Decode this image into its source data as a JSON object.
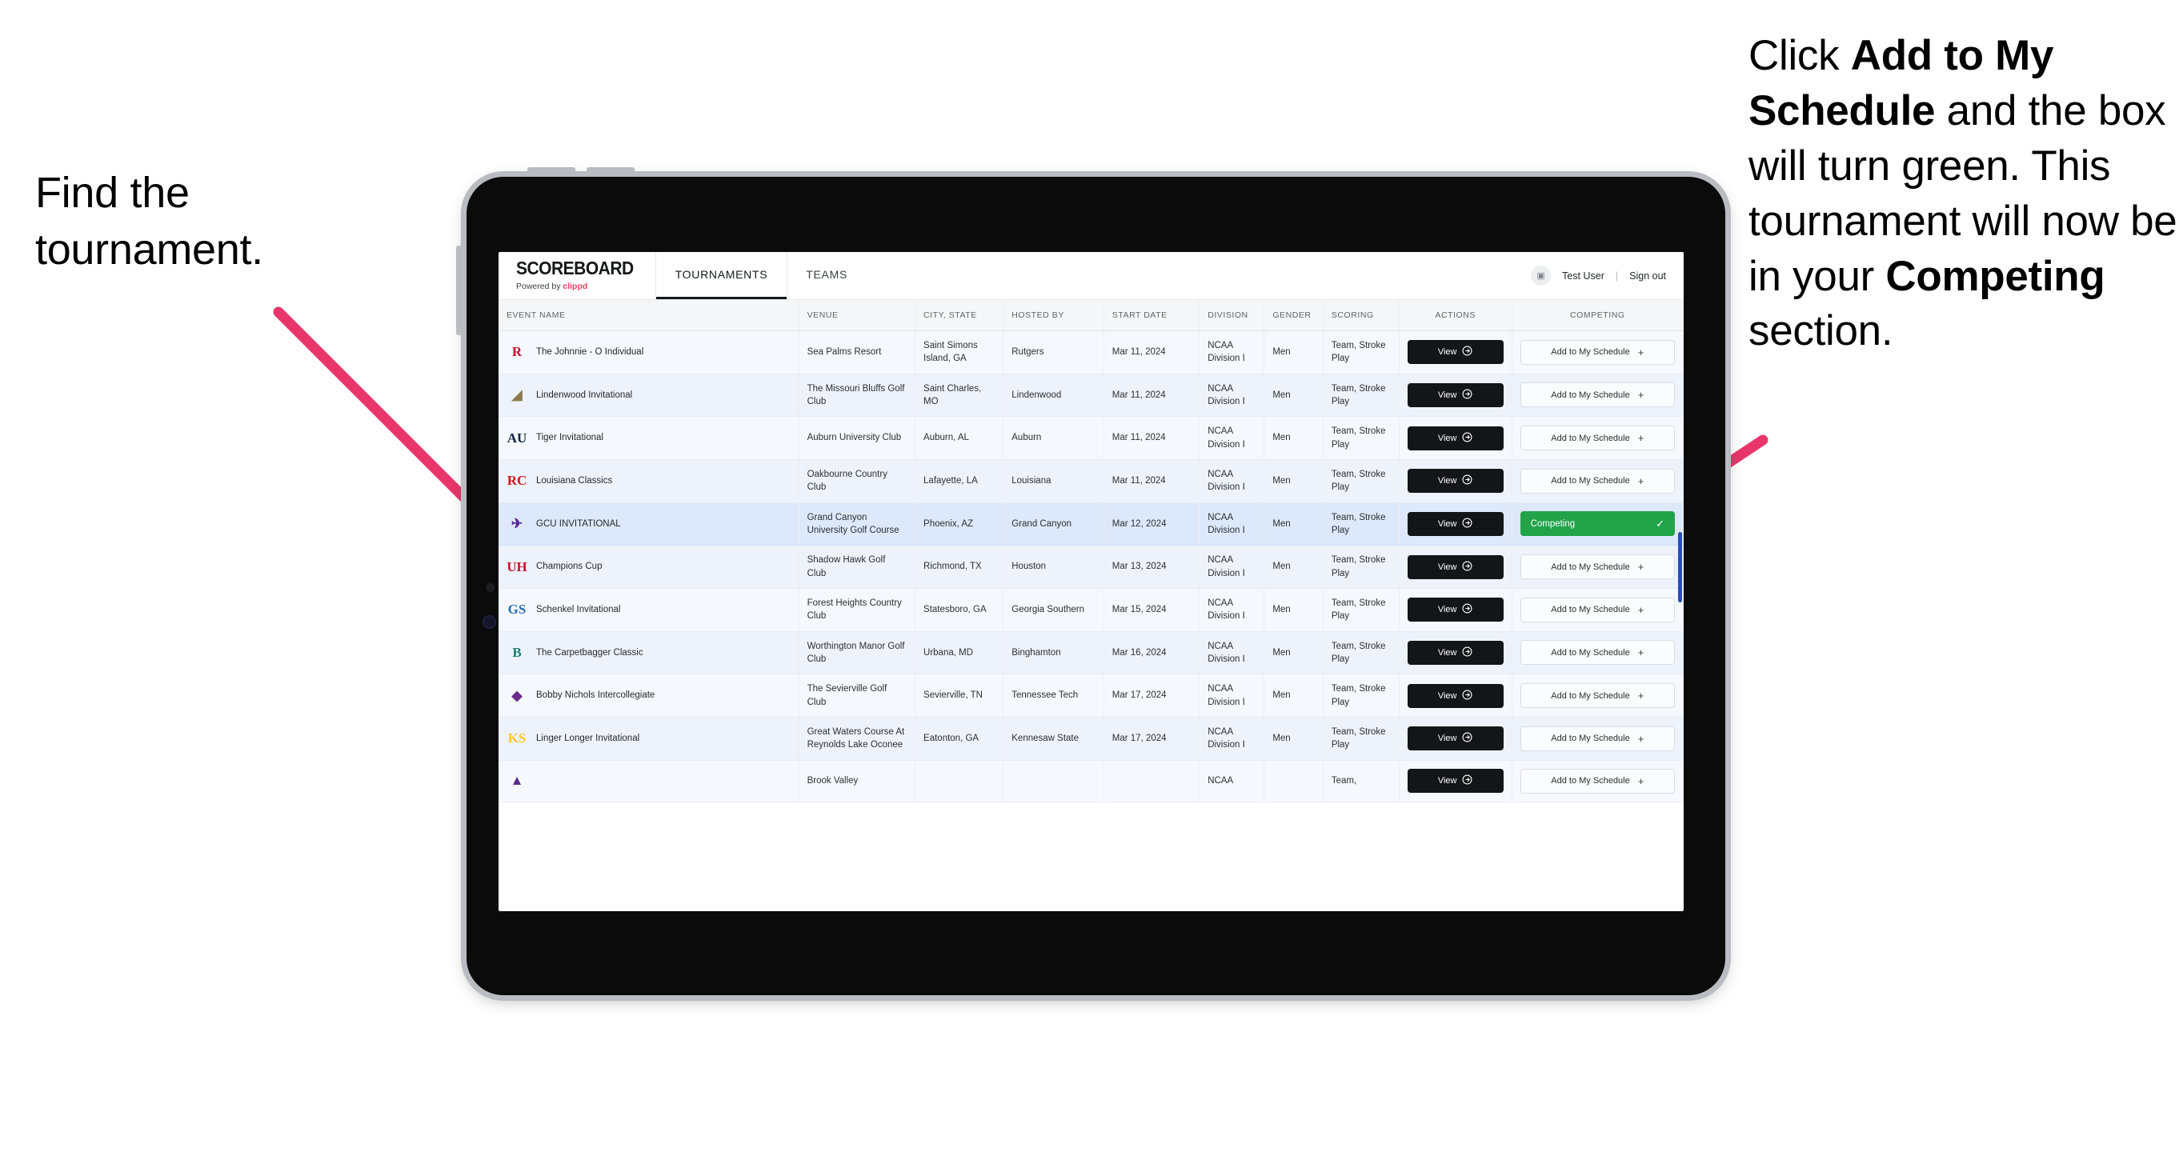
{
  "annotations": {
    "left": {
      "line1": "Find the",
      "line2": "tournament."
    },
    "right": {
      "part1": "Click ",
      "bold1": "Add to My Schedule",
      "part2": " and the box will turn green. This tournament will now be in your ",
      "bold2": "Competing",
      "part3": " section."
    },
    "arrow_color": "#e8366b"
  },
  "app": {
    "brand": {
      "name": "SCOREBOARD",
      "powered_prefix": "Powered by ",
      "powered_brand": "clippd"
    },
    "tabs": [
      {
        "label": "TOURNAMENTS",
        "active": true
      },
      {
        "label": "TEAMS",
        "active": false
      }
    ],
    "header_right": {
      "avatar_icon": "user-avatar-icon",
      "user_name": "Test User",
      "separator": "|",
      "sign_out": "Sign out"
    }
  },
  "table": {
    "columns": [
      "EVENT NAME",
      "VENUE",
      "CITY, STATE",
      "HOSTED BY",
      "START DATE",
      "DIVISION",
      "GENDER",
      "SCORING",
      "ACTIONS",
      "COMPETING"
    ],
    "action_label": "View",
    "add_label": "Add to My Schedule",
    "add_icon": "plus-icon",
    "competing_label": "Competing",
    "competing_icon": "check-icon",
    "competing_color": "#22a34a",
    "rows": [
      {
        "logo": "R",
        "logo_color": "#c8102e",
        "event": "The Johnnie - O Individual",
        "venue": "Sea Palms Resort",
        "city": "Saint Simons Island, GA",
        "hosted_by": "Rutgers",
        "start_date": "Mar 11, 2024",
        "division": "NCAA Division I",
        "gender": "Men",
        "scoring": "Team, Stroke Play",
        "competing": false
      },
      {
        "logo": "◢",
        "logo_color": "#8a7b4f",
        "event": "Lindenwood Invitational",
        "venue": "The Missouri Bluffs Golf Club",
        "city": "Saint Charles, MO",
        "hosted_by": "Lindenwood",
        "start_date": "Mar 11, 2024",
        "division": "NCAA Division I",
        "gender": "Men",
        "scoring": "Team, Stroke Play",
        "competing": false
      },
      {
        "logo": "AU",
        "logo_color": "#0c2340",
        "event": "Tiger Invitational",
        "venue": "Auburn University Club",
        "city": "Auburn, AL",
        "hosted_by": "Auburn",
        "start_date": "Mar 11, 2024",
        "division": "NCAA Division I",
        "gender": "Men",
        "scoring": "Team, Stroke Play",
        "competing": false
      },
      {
        "logo": "RC",
        "logo_color": "#ce181e",
        "event": "Louisiana Classics",
        "venue": "Oakbourne Country Club",
        "city": "Lafayette, LA",
        "hosted_by": "Louisiana",
        "start_date": "Mar 11, 2024",
        "division": "NCAA Division I",
        "gender": "Men",
        "scoring": "Team, Stroke Play",
        "competing": false
      },
      {
        "logo": "✈",
        "logo_color": "#522398",
        "event": "GCU INVITATIONAL",
        "venue": "Grand Canyon University Golf Course",
        "city": "Phoenix, AZ",
        "hosted_by": "Grand Canyon",
        "start_date": "Mar 12, 2024",
        "division": "NCAA Division I",
        "gender": "Men",
        "scoring": "Team, Stroke Play",
        "competing": true
      },
      {
        "logo": "UH",
        "logo_color": "#c8102e",
        "event": "Champions Cup",
        "venue": "Shadow Hawk Golf Club",
        "city": "Richmond, TX",
        "hosted_by": "Houston",
        "start_date": "Mar 13, 2024",
        "division": "NCAA Division I",
        "gender": "Men",
        "scoring": "Team, Stroke Play",
        "competing": false
      },
      {
        "logo": "GS",
        "logo_color": "#2b6cb0",
        "event": "Schenkel Invitational",
        "venue": "Forest Heights Country Club",
        "city": "Statesboro, GA",
        "hosted_by": "Georgia Southern",
        "start_date": "Mar 15, 2024",
        "division": "NCAA Division I",
        "gender": "Men",
        "scoring": "Team, Stroke Play",
        "competing": false
      },
      {
        "logo": "B",
        "logo_color": "#1a7f74",
        "event": "The Carpetbagger Classic",
        "venue": "Worthington Manor Golf Club",
        "city": "Urbana, MD",
        "hosted_by": "Binghamton",
        "start_date": "Mar 16, 2024",
        "division": "NCAA Division I",
        "gender": "Men",
        "scoring": "Team, Stroke Play",
        "competing": false
      },
      {
        "logo": "◆",
        "logo_color": "#6b2d8b",
        "event": "Bobby Nichols Intercollegiate",
        "venue": "The Sevierville Golf Club",
        "city": "Sevierville, TN",
        "hosted_by": "Tennessee Tech",
        "start_date": "Mar 17, 2024",
        "division": "NCAA Division I",
        "gender": "Men",
        "scoring": "Team, Stroke Play",
        "competing": false
      },
      {
        "logo": "KS",
        "logo_color": "#ffc629",
        "event": "Linger Longer Invitational",
        "venue": "Great Waters Course At Reynolds Lake Oconee",
        "city": "Eatonton, GA",
        "hosted_by": "Kennesaw State",
        "start_date": "Mar 17, 2024",
        "division": "NCAA Division I",
        "gender": "Men",
        "scoring": "Team, Stroke Play",
        "competing": false
      },
      {
        "logo": "▲",
        "logo_color": "#5b2a86",
        "event": "",
        "venue": "Brook Valley",
        "city": "",
        "hosted_by": "",
        "start_date": "",
        "division": "NCAA",
        "gender": "",
        "scoring": "Team,",
        "competing": false,
        "cut_off": true
      }
    ]
  }
}
